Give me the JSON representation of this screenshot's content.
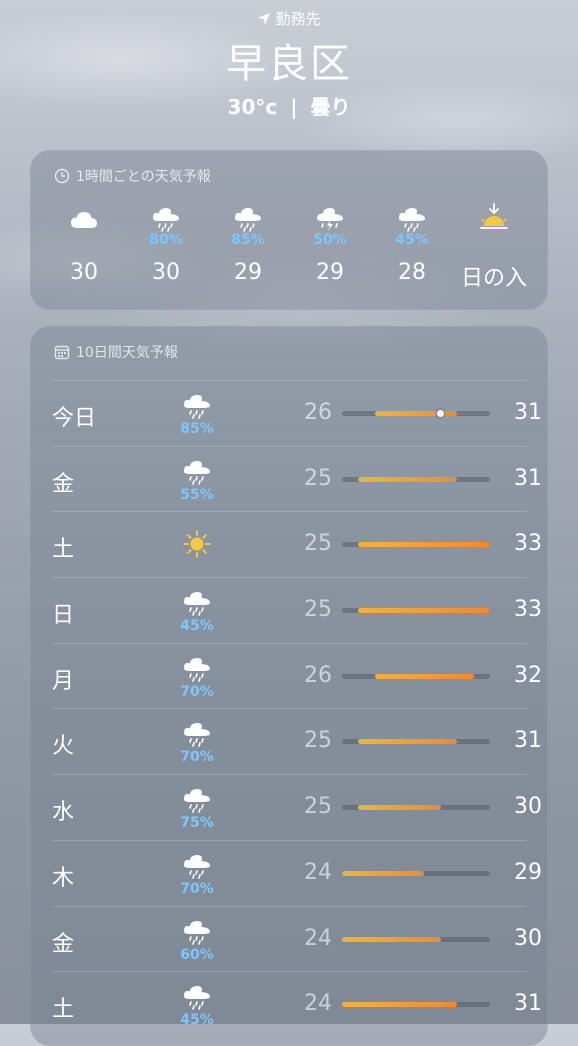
{
  "header": {
    "location_label": "勤務先",
    "city": "早良区",
    "current_temp": "30°c",
    "separator": "|",
    "condition": "曇り"
  },
  "hourly": {
    "title": "1時間ごとの天気予報",
    "items": [
      {
        "icon": "cloud-icon",
        "pop": "",
        "temp": "30"
      },
      {
        "icon": "cloud-rain-icon",
        "pop": "80%",
        "temp": "30"
      },
      {
        "icon": "cloud-rain-icon",
        "pop": "85%",
        "temp": "29"
      },
      {
        "icon": "cloud-bolt-rain-icon",
        "pop": "50%",
        "temp": "29"
      },
      {
        "icon": "cloud-rain-icon",
        "pop": "45%",
        "temp": "28"
      },
      {
        "icon": "sunset-icon",
        "pop": "",
        "temp": "日の入"
      }
    ]
  },
  "daily": {
    "title": "10日間天気予報",
    "range_min": 24,
    "range_max": 33,
    "days": [
      {
        "day": "今日",
        "icon": "cloud-rain-icon",
        "pop": "85%",
        "low": "26",
        "high": "31",
        "current": 30
      },
      {
        "day": "金",
        "icon": "cloud-rain-icon",
        "pop": "55%",
        "low": "25",
        "high": "31"
      },
      {
        "day": "土",
        "icon": "sun-icon",
        "pop": "",
        "low": "25",
        "high": "33"
      },
      {
        "day": "日",
        "icon": "cloud-rain-icon",
        "pop": "45%",
        "low": "25",
        "high": "33"
      },
      {
        "day": "月",
        "icon": "cloud-rain-icon",
        "pop": "70%",
        "low": "26",
        "high": "32"
      },
      {
        "day": "火",
        "icon": "cloud-rain-icon",
        "pop": "70%",
        "low": "25",
        "high": "31"
      },
      {
        "day": "水",
        "icon": "cloud-rain-icon",
        "pop": "75%",
        "low": "25",
        "high": "30"
      },
      {
        "day": "木",
        "icon": "cloud-rain-icon",
        "pop": "70%",
        "low": "24",
        "high": "29"
      },
      {
        "day": "金",
        "icon": "cloud-rain-icon",
        "pop": "60%",
        "low": "24",
        "high": "30"
      },
      {
        "day": "土",
        "icon": "cloud-rain-icon",
        "pop": "45%",
        "low": "24",
        "high": "31"
      }
    ]
  },
  "colors": {
    "precip": "#7cc7ff",
    "temp_bar_start": "#f2b33a",
    "temp_bar_end": "#f08a2e",
    "sun": "#f5c842"
  }
}
